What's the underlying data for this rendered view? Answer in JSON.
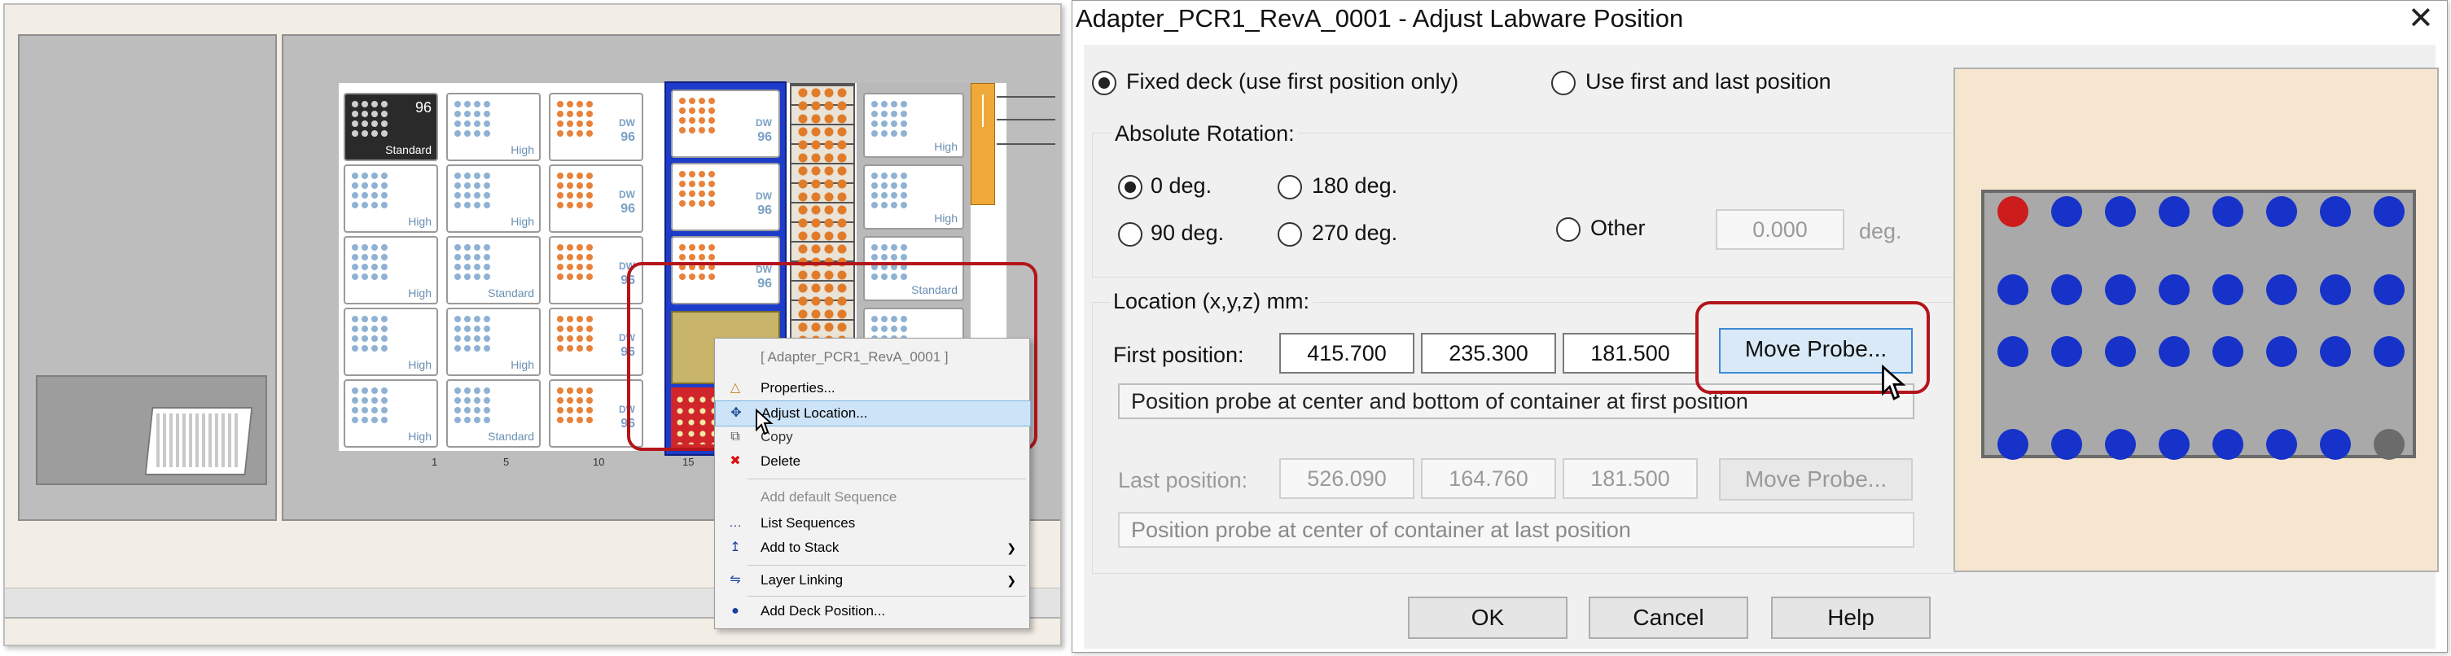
{
  "deck": {
    "columns": [
      "1",
      "5",
      "10",
      "15"
    ],
    "tiles": [
      {
        "num": "96",
        "label": "Standard"
      },
      {
        "label": "High"
      },
      {
        "dw": "DW",
        "dwn": "96"
      },
      {
        "label": "High"
      },
      {
        "label": "High"
      },
      {
        "label": "High"
      },
      {
        "dw": "DW",
        "dwn": "96"
      },
      {
        "label": "High"
      },
      {
        "label": "High"
      },
      {
        "label": "Standard"
      },
      {
        "dw": "DW",
        "dwn": "96"
      },
      {
        "label": "Standard"
      },
      {
        "label": "High"
      },
      {
        "label": "High"
      },
      {
        "dw": "DW",
        "dwn": "96"
      },
      {
        "label": "High"
      },
      {
        "label": "High"
      },
      {
        "label": "Standard"
      },
      {
        "dw": "DW",
        "dwn": "96"
      },
      {
        "label": "High"
      }
    ],
    "blue_tiles": [
      {
        "dw": "DW",
        "dwn": "96"
      },
      {
        "dw": "DW",
        "dwn": "96"
      },
      {
        "dw": "DW",
        "dwn": "96"
      }
    ]
  },
  "context_menu": {
    "header": "[ Adapter_PCR1_RevA_0001 ]",
    "properties": "Properties...",
    "adjust_location": "Adjust Location...",
    "copy": "Copy",
    "delete": "Delete",
    "add_default_sequence": "Add default Sequence",
    "list_sequences": "List Sequences",
    "add_to_stack": "Add to Stack",
    "layer_linking": "Layer Linking",
    "add_deck_position": "Add Deck Position..."
  },
  "dialog": {
    "title": "Adapter_PCR1_RevA_0001 - Adjust Labware Position",
    "fixed_deck": "Fixed deck (use first position only)",
    "first_last": "Use first and last position",
    "rotation_group": "Absolute Rotation:",
    "rot_0": "0 deg.",
    "rot_180": "180 deg.",
    "rot_90": "90 deg.",
    "rot_270": "270 deg.",
    "rot_other": "Other",
    "rot_other_value": "0.000",
    "rot_other_unit": "deg.",
    "location_group": "Location (x,y,z) mm:",
    "first_position_label": "First position:",
    "first_x": "415.700",
    "first_y": "235.300",
    "first_z": "181.500",
    "move_probe": "Move Probe...",
    "first_hint": "Position probe at center and bottom of container at first position",
    "last_position_label": "Last position:",
    "last_x": "526.090",
    "last_y": "164.760",
    "last_z": "181.500",
    "move_probe_last": "Move Probe...",
    "last_hint": "Position probe at center of container at last position",
    "ok": "OK",
    "cancel": "Cancel",
    "help": "Help"
  },
  "colors": {
    "highlight_red": "#b3151b",
    "well_blue": "#1632c8",
    "first_well": "#cc1c1c",
    "last_well": "#6b6b6b",
    "deck_blue": "#1d3cc9"
  }
}
